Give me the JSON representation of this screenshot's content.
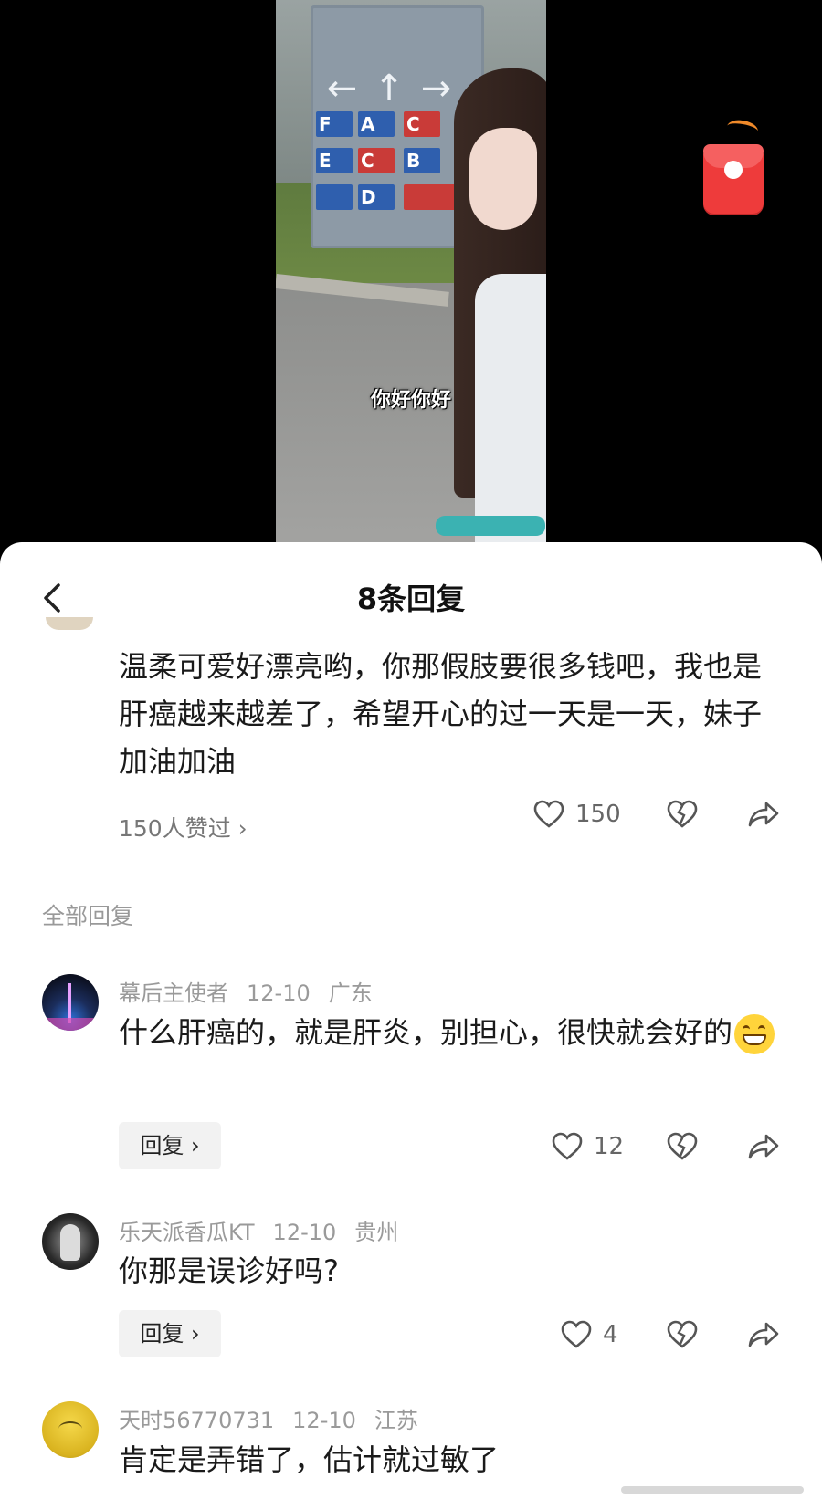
{
  "video": {
    "subtitle": "你好你好"
  },
  "sheet": {
    "title": "8条回复",
    "main_comment": {
      "text": "温柔可爱好漂亮哟，你那假肢要很多钱吧，我也是肝癌越来越差了，希望开心的过一天是一天，妹子加油加油",
      "likes_summary": "150人赞过 ›",
      "like_count": "150"
    },
    "section_label": "全部回复",
    "replies": [
      {
        "user": "幕后主使者",
        "date": "12-10",
        "location": "广东",
        "text": "什么肝癌的，就是肝炎，别担心，很快就会好的",
        "reply_label": "回复 ›",
        "like_count": "12"
      },
      {
        "user": "乐天派香瓜KT",
        "date": "12-10",
        "location": "贵州",
        "text": "你那是误诊好吗?",
        "reply_label": "回复 ›",
        "like_count": "4"
      },
      {
        "user": "天时56770731",
        "date": "12-10",
        "location": "江苏",
        "text": "肯定是弄错了，估计就过敏了"
      }
    ]
  },
  "icons": {
    "back": "chevron-left-icon",
    "like": "heart-outline-icon",
    "dislike": "broken-heart-icon",
    "share": "share-arrow-icon",
    "red_packet": "red-packet-icon",
    "emoji": "grinning-emoji-icon"
  },
  "colors": {
    "red_packet": "#ee3b3b",
    "text": "#1a1a1a",
    "meta": "#9a9a9a"
  }
}
